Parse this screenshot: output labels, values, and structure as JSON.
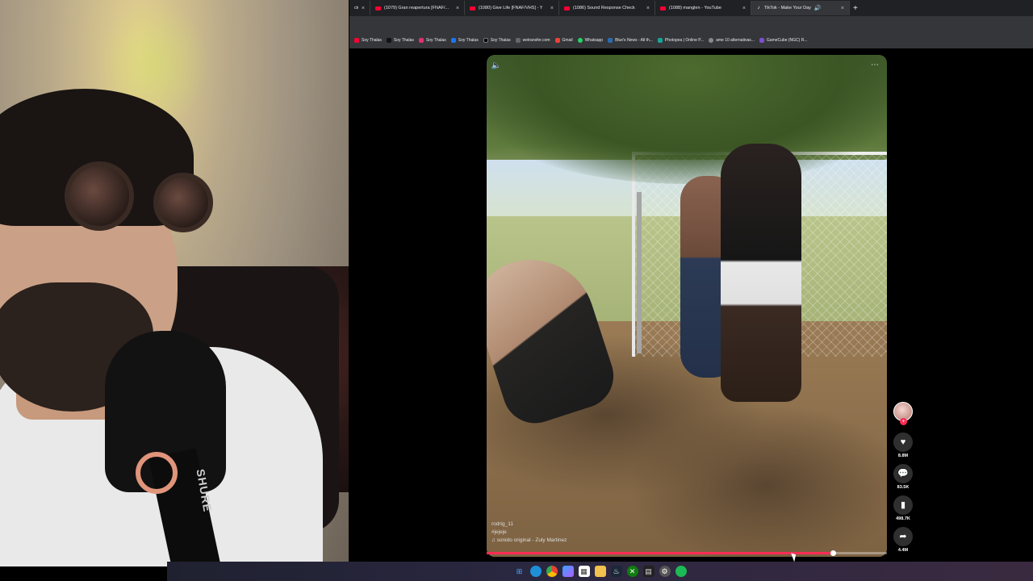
{
  "browser": {
    "tabs": [
      {
        "label": "cto",
        "favicon": "none",
        "active": false
      },
      {
        "label": "(1079) Gran reapertura [FNAF/...",
        "favicon": "youtube",
        "active": false
      },
      {
        "label": "(1080) Give Life [FNAF/VHS] - Y",
        "favicon": "youtube",
        "active": false
      },
      {
        "label": "(1086) Sound Response Check",
        "favicon": "youtube",
        "active": false
      },
      {
        "label": "(1088) manglen - YouTube",
        "favicon": "youtube",
        "active": false
      },
      {
        "label": "TikTok - Make Your Day",
        "favicon": "tiktok",
        "active": true
      }
    ],
    "bookmarks": [
      {
        "label": "Soy Thalas",
        "icon_color": "#ff0033"
      },
      {
        "label": "Soy Thalas",
        "icon_color": "#111111"
      },
      {
        "label": "Soy Thalas",
        "icon_color": "#e1306c"
      },
      {
        "label": "Soy Thalas",
        "icon_color": "#1877f2"
      },
      {
        "label": "Soy Thalas",
        "icon_color": "#000000"
      },
      {
        "label": "wetransfer.com",
        "icon_color": "#666666"
      },
      {
        "label": "Gmail",
        "icon_color": "#ea4335"
      },
      {
        "label": "Whatsapp",
        "icon_color": "#25d366"
      },
      {
        "label": "Blue's News - All th...",
        "icon_color": "#2b6cb0"
      },
      {
        "label": "Photopea | Online P...",
        "icon_color": "#18a497"
      },
      {
        "label": "ame 10 alternativas...",
        "icon_color": "#888888"
      },
      {
        "label": "GameCube (NGC) R...",
        "icon_color": "#7a4fd1"
      }
    ]
  },
  "video": {
    "username": "rodrig_11",
    "hashtag": "#jejeje",
    "sound": "♫ sonido original - Zuly Martinez",
    "progress": 0.865,
    "sound_icon": "speaker-icon",
    "more_icon": "ellipsis-icon"
  },
  "actions": {
    "likes": "8.8M",
    "comments": "83.5K",
    "saves": "498.7K",
    "shares": "4.4M"
  },
  "taskbar": {
    "icons": [
      "windows-start-icon",
      "edge-icon",
      "chrome-icon",
      "copilot-icon",
      "store-icon",
      "files-icon",
      "steam-icon",
      "xbox-icon",
      "terminal-icon",
      "settings-icon",
      "spotify-icon"
    ]
  },
  "colors": {
    "accent": "#fe2c55",
    "chrome_dark": "#202124",
    "chrome_mid": "#35363a"
  }
}
